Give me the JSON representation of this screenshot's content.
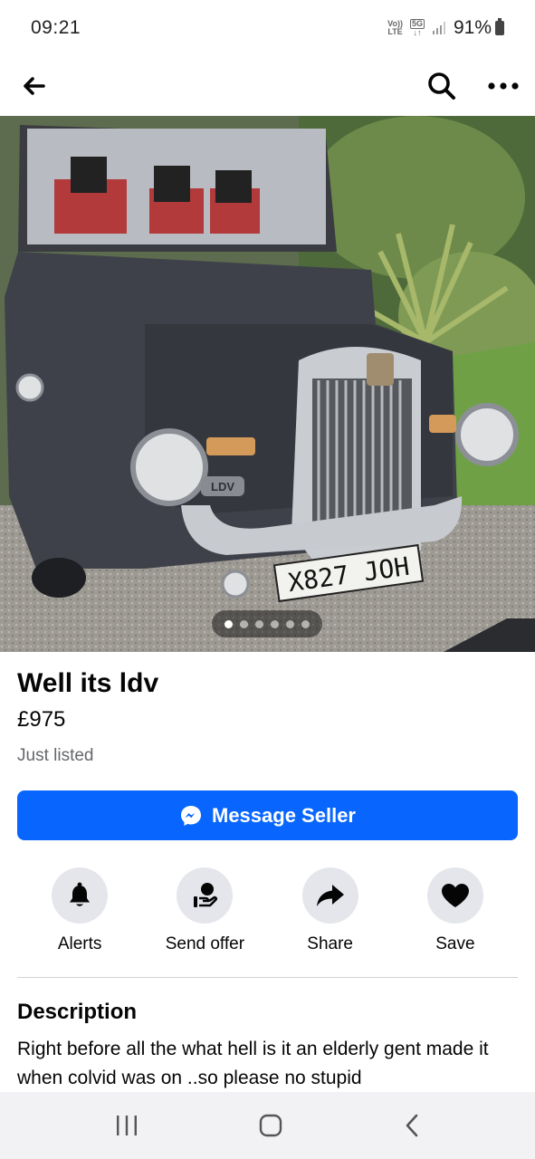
{
  "status_bar": {
    "time": "09:21",
    "volte_top": "Vo))",
    "volte_bottom": "LTE",
    "network": "5G",
    "battery": "91%"
  },
  "nav": {
    "back_icon": "arrow-left-icon",
    "search_icon": "search-icon",
    "more_icon": "more-horizontal-icon"
  },
  "photo": {
    "plate": "X827 JOH",
    "badge": "LDV",
    "carousel_count": 6,
    "carousel_active": 0
  },
  "listing": {
    "title": "Well its ldv",
    "price": "£975",
    "listed": "Just listed",
    "message_button": "Message Seller"
  },
  "actions": [
    {
      "label": "Alerts",
      "icon": "bell-icon"
    },
    {
      "label": "Send offer",
      "icon": "offer-hand-icon"
    },
    {
      "label": "Share",
      "icon": "share-arrow-icon"
    },
    {
      "label": "Save",
      "icon": "heart-icon"
    }
  ],
  "description": {
    "heading": "Description",
    "text": "Right  before all the what hell is it an elderly  gent made it when colvid was on ..so please no stupid"
  },
  "colors": {
    "accent": "#0866ff",
    "action_bg": "#e4e6eb",
    "muted_text": "#65676b"
  }
}
